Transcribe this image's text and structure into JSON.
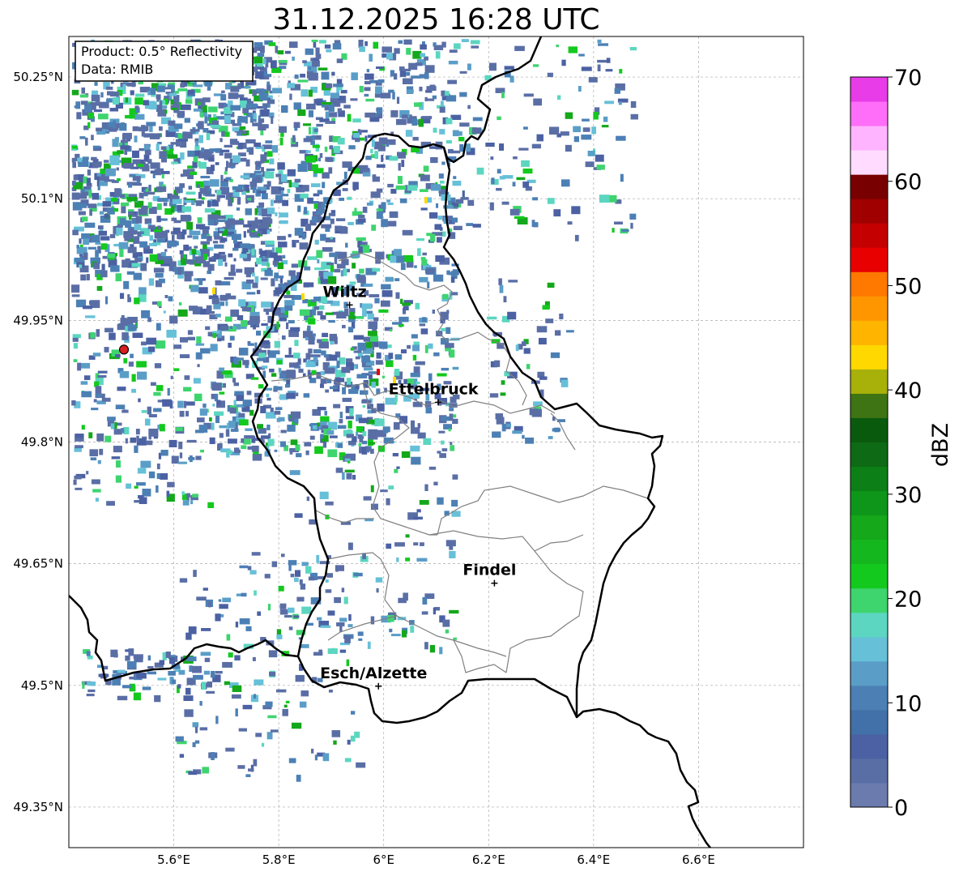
{
  "title": "31.12.2025 16:28 UTC",
  "info_box": {
    "product_line": "Product: 0.5° Reflectivity",
    "data_line": "Data: RMIB"
  },
  "axes": {
    "x_ticks": [
      "5.6°E",
      "5.8°E",
      "6°E",
      "6.2°E",
      "6.4°E",
      "6.6°E"
    ],
    "y_ticks": [
      "50.25°N",
      "50.1°N",
      "49.95°N",
      "49.8°N",
      "49.65°N",
      "49.5°N",
      "49.35°N"
    ],
    "x_values": [
      5.6,
      5.8,
      6.0,
      6.2,
      6.4,
      6.6
    ],
    "y_values": [
      50.25,
      50.1,
      49.95,
      49.8,
      49.65,
      49.5,
      49.35
    ],
    "lon_range": [
      5.4,
      6.8
    ],
    "lat_range": [
      49.3,
      50.3
    ],
    "grid": true
  },
  "cities": [
    {
      "name": "Wiltz",
      "lon": 5.935,
      "lat": 49.969
    },
    {
      "name": "Ettelbruck",
      "lon": 6.104,
      "lat": 49.849
    },
    {
      "name": "Findel",
      "lon": 6.211,
      "lat": 49.626
    },
    {
      "name": "Esch/Alzette",
      "lon": 5.99,
      "lat": 49.499
    }
  ],
  "radar_site": {
    "lon": 5.505,
    "lat": 49.914
  },
  "colorbar": {
    "label": "dBZ",
    "ticks": [
      "0",
      "10",
      "20",
      "30",
      "40",
      "50",
      "60",
      "70"
    ],
    "min": 0,
    "max": 70,
    "colors": [
      "#6b7bad",
      "#5a6ea6",
      "#4b61a3",
      "#4270a8",
      "#4c80b5",
      "#5a9ec8",
      "#66c0d8",
      "#5cd6c0",
      "#3ed46e",
      "#14c91e",
      "#14b81e",
      "#14a81a",
      "#0e961a",
      "#0c8016",
      "#0e6a14",
      "#0a5a0e",
      "#3e7414",
      "#a8b00a",
      "#ffd800",
      "#ffb400",
      "#ff9600",
      "#ff7800",
      "#e80000",
      "#c40000",
      "#a00000",
      "#780000",
      "#ffdcff",
      "#ffb4ff",
      "#ff6ef8",
      "#e83ce8"
    ]
  }
}
